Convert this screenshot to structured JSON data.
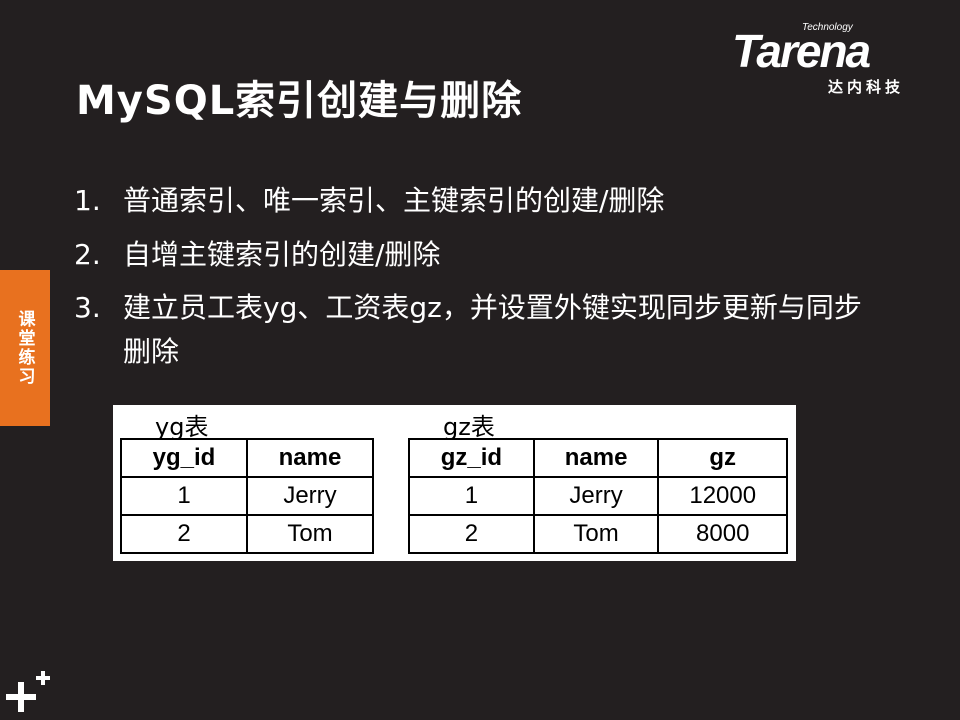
{
  "slide": {
    "title": "MySQL索引创建与删除",
    "side_tab": "课堂练习",
    "items": [
      {
        "num": "1.",
        "text": "普通索引、唯一索引、主键索引的创建/删除"
      },
      {
        "num": "2.",
        "text": "自增主键索引的创建/删除"
      },
      {
        "num": "3.",
        "text": "建立员工表yg、工资表gz，并设置外键实现同步更新与同步删除"
      }
    ]
  },
  "logo": {
    "technology": "Technology",
    "word": "Tarena",
    "cn": "达内科技"
  },
  "yg_table": {
    "caption": "yg表",
    "headers": [
      "yg_id",
      "name"
    ],
    "rows": [
      [
        "1",
        "Jerry"
      ],
      [
        "2",
        "Tom"
      ]
    ]
  },
  "gz_table": {
    "caption": "gz表",
    "headers": [
      "gz_id",
      "name",
      "gz"
    ],
    "rows": [
      [
        "1",
        "Jerry",
        "12000"
      ],
      [
        "2",
        "Tom",
        "8000"
      ]
    ]
  },
  "icons": {
    "corner": "plus-icon"
  },
  "colors": {
    "background": "#231f20",
    "accent": "#e8711f",
    "text": "#ffffff"
  }
}
